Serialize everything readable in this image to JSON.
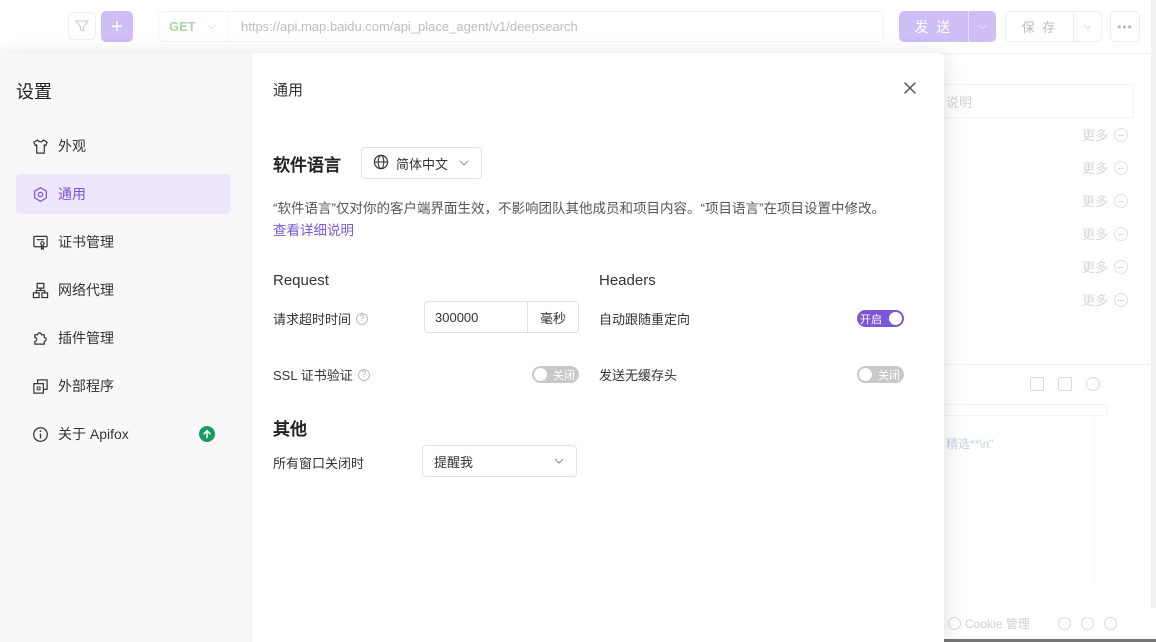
{
  "background": {
    "method": "GET",
    "url": "https://api.map.baidu.com/api_place_agent/v1/deepsearch",
    "send_label": "发 送",
    "save_label": "保 存",
    "desc_placeholder": "说明",
    "more_label": "更多",
    "code_snippet": "精选**\\n\"",
    "cookie_label": "Cookie 管理"
  },
  "settings": {
    "title": "设置",
    "nav": [
      {
        "label": "外观",
        "icon": "shirt-icon"
      },
      {
        "label": "通用",
        "icon": "general-icon",
        "active": true
      },
      {
        "label": "证书管理",
        "icon": "certificate-icon"
      },
      {
        "label": "网络代理",
        "icon": "network-icon"
      },
      {
        "label": "插件管理",
        "icon": "plugin-icon"
      },
      {
        "label": "外部程序",
        "icon": "external-icon"
      },
      {
        "label": "关于 Apifox",
        "icon": "info-icon",
        "badge": "update-available"
      }
    ]
  },
  "general": {
    "title": "通用",
    "language_label": "软件语言",
    "language_value": "简体中文",
    "language_desc": "“软件语言”仅对你的客户端界面生效，不影响团队其他成员和项目内容。“项目语言”在项目设置中修改。",
    "language_link": "查看详细说明",
    "request_title": "Request",
    "headers_title": "Headers",
    "timeout_label": "请求超时时间",
    "timeout_value": "300000",
    "timeout_unit": "毫秒",
    "ssl_label": "SSL 证书验证",
    "ssl_state": "关闭",
    "redirect_label": "自动跟随重定向",
    "redirect_state": "开启",
    "no_cache_label": "发送无缓存头",
    "no_cache_state": "关闭",
    "other_title": "其他",
    "window_close_label": "所有窗口关闭时",
    "window_close_value": "提醒我"
  },
  "colors": {
    "accent": "#7b57d8",
    "accent_light": "#ede6fc",
    "update_badge": "#1a9a64"
  }
}
